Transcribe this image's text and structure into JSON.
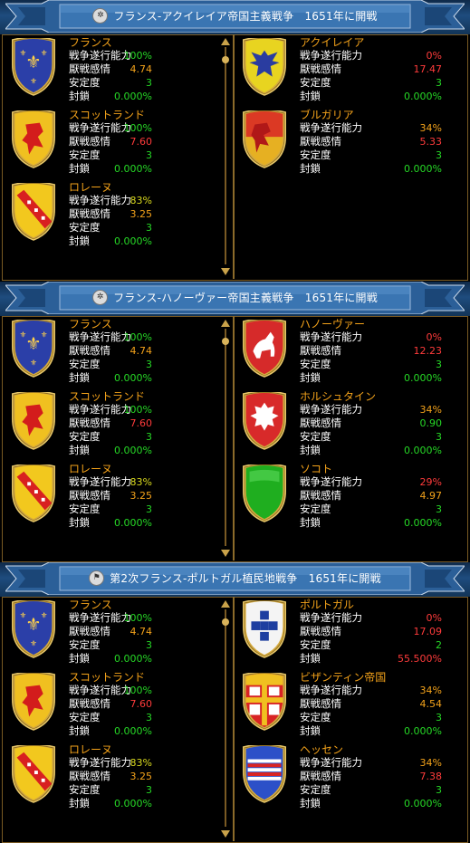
{
  "row_labels": [
    "戦争遂行能力",
    "厭戦感情",
    "安定度",
    "封鎖"
  ],
  "wars": [
    {
      "icon": "globe-icon",
      "title": "フランス-アクイレイア帝国主義戦争　1651年に開戦",
      "left": [
        {
          "name": "フランス",
          "shield": "france",
          "values": [
            "100%",
            "4.74",
            "3",
            "0.000%"
          ],
          "colors": [
            "green",
            "orange",
            "green",
            "green"
          ]
        },
        {
          "name": "スコットランド",
          "shield": "scotland",
          "values": [
            "100%",
            "7.60",
            "3",
            "0.000%"
          ],
          "colors": [
            "green",
            "red",
            "green",
            "green"
          ]
        },
        {
          "name": "ロレーヌ",
          "shield": "lorraine",
          "values": [
            "83%",
            "3.25",
            "3",
            "0.000%"
          ],
          "colors": [
            "yellow",
            "orange",
            "green",
            "green"
          ]
        }
      ],
      "right": [
        {
          "name": "アクイレイア",
          "shield": "aquileia",
          "values": [
            "0%",
            "17.47",
            "3",
            "0.000%"
          ],
          "colors": [
            "red",
            "red",
            "green",
            "green"
          ]
        },
        {
          "name": "ブルガリア",
          "shield": "bulgaria",
          "values": [
            "34%",
            "5.33",
            "3",
            "0.000%"
          ],
          "colors": [
            "orange",
            "red",
            "green",
            "green"
          ]
        }
      ]
    },
    {
      "icon": "globe-icon",
      "title": "フランス-ハノーヴァー帝国主義戦争　1651年に開戦",
      "left": [
        {
          "name": "フランス",
          "shield": "france",
          "values": [
            "100%",
            "4.74",
            "3",
            "0.000%"
          ],
          "colors": [
            "green",
            "orange",
            "green",
            "green"
          ]
        },
        {
          "name": "スコットランド",
          "shield": "scotland",
          "values": [
            "100%",
            "7.60",
            "3",
            "0.000%"
          ],
          "colors": [
            "green",
            "red",
            "green",
            "green"
          ]
        },
        {
          "name": "ロレーヌ",
          "shield": "lorraine",
          "values": [
            "83%",
            "3.25",
            "3",
            "0.000%"
          ],
          "colors": [
            "yellow",
            "orange",
            "green",
            "green"
          ]
        }
      ],
      "right": [
        {
          "name": "ハノーヴァー",
          "shield": "hanover",
          "values": [
            "0%",
            "12.23",
            "3",
            "0.000%"
          ],
          "colors": [
            "red",
            "red",
            "green",
            "green"
          ]
        },
        {
          "name": "ホルシュタイン",
          "shield": "holstein",
          "values": [
            "34%",
            "0.90",
            "3",
            "0.000%"
          ],
          "colors": [
            "orange",
            "green",
            "green",
            "green"
          ]
        },
        {
          "name": "ソコト",
          "shield": "sokoto",
          "values": [
            "29%",
            "4.97",
            "3",
            "0.000%"
          ],
          "colors": [
            "red",
            "orange",
            "green",
            "green"
          ]
        }
      ]
    },
    {
      "icon": "colonial-icon",
      "title": "第2次フランス-ポルトガル植民地戦争　1651年に開戦",
      "left": [
        {
          "name": "フランス",
          "shield": "france",
          "values": [
            "100%",
            "4.74",
            "3",
            "0.000%"
          ],
          "colors": [
            "green",
            "orange",
            "green",
            "green"
          ]
        },
        {
          "name": "スコットランド",
          "shield": "scotland",
          "values": [
            "100%",
            "7.60",
            "3",
            "0.000%"
          ],
          "colors": [
            "green",
            "red",
            "green",
            "green"
          ]
        },
        {
          "name": "ロレーヌ",
          "shield": "lorraine",
          "values": [
            "83%",
            "3.25",
            "3",
            "0.000%"
          ],
          "colors": [
            "yellow",
            "orange",
            "green",
            "green"
          ]
        }
      ],
      "right": [
        {
          "name": "ポルトガル",
          "shield": "portugal",
          "values": [
            "0%",
            "17.09",
            "2",
            "55.500%"
          ],
          "colors": [
            "red",
            "red",
            "green",
            "red"
          ]
        },
        {
          "name": "ビザンティン帝国",
          "shield": "byzantium",
          "values": [
            "34%",
            "4.54",
            "3",
            "0.000%"
          ],
          "colors": [
            "orange",
            "orange",
            "green",
            "green"
          ]
        },
        {
          "name": "ヘッセン",
          "shield": "hesse",
          "values": [
            "34%",
            "7.38",
            "3",
            "0.000%"
          ],
          "colors": [
            "orange",
            "red",
            "green",
            "green"
          ]
        }
      ]
    }
  ],
  "colors": {
    "header_blue": "#1e4c7e",
    "gold": "#c9a24a",
    "name_orange": "#f3a21a",
    "green": "#26d826",
    "red": "#ff3b3b",
    "yellow": "#d8d81e"
  }
}
